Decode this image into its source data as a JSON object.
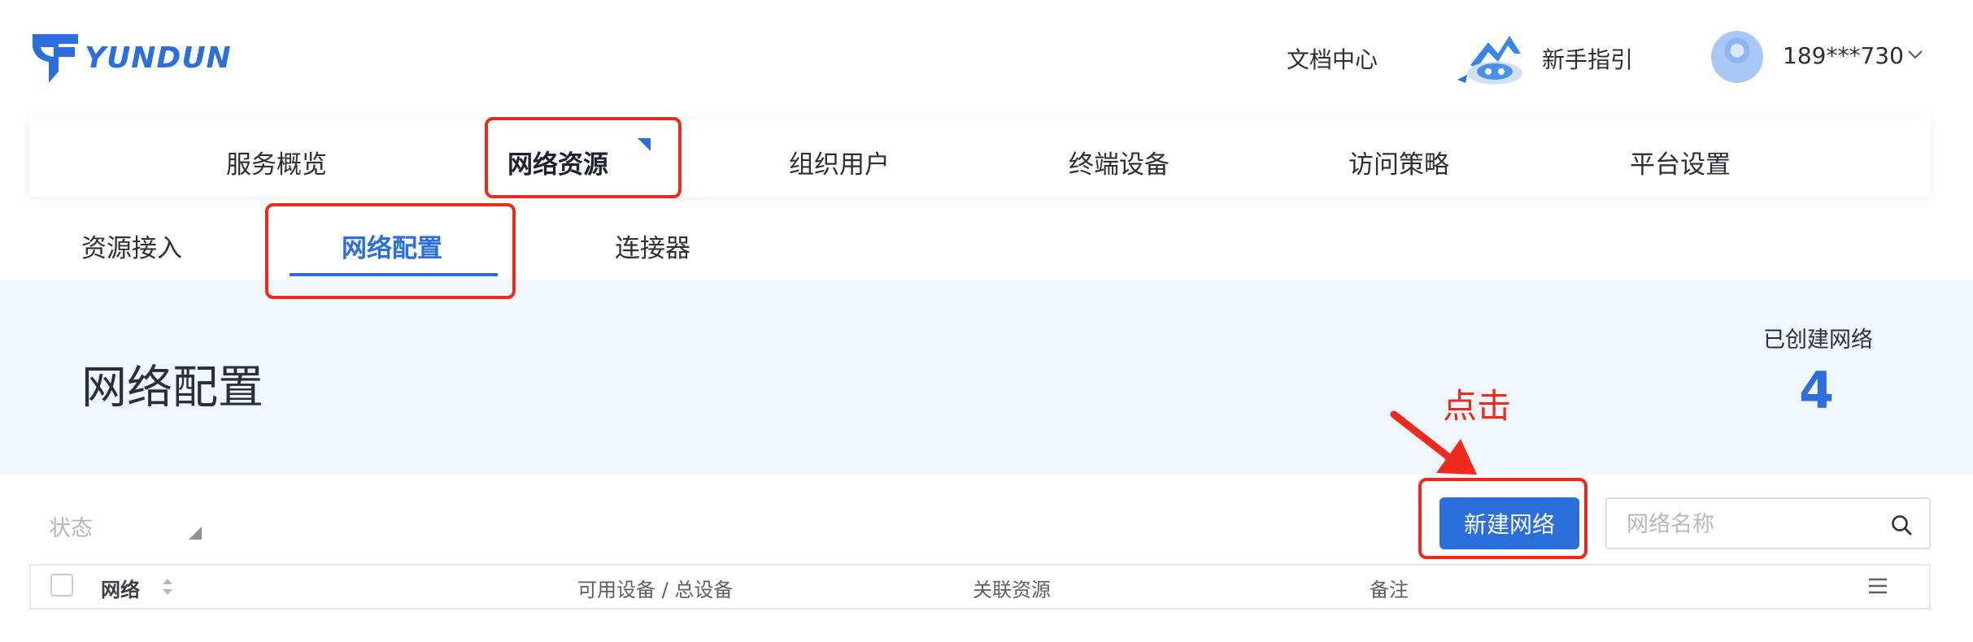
{
  "header": {
    "logo_text": "YUNDUN",
    "docs_label": "文档中心",
    "guide_label": "新手指引",
    "user_label": "189***730"
  },
  "main_nav": {
    "items": [
      {
        "label": "服务概览"
      },
      {
        "label": "网络资源",
        "active": true
      },
      {
        "label": "组织用户"
      },
      {
        "label": "终端设备"
      },
      {
        "label": "访问策略"
      },
      {
        "label": "平台设置"
      }
    ]
  },
  "sub_nav": {
    "items": [
      {
        "label": "资源接入"
      },
      {
        "label": "网络配置",
        "active": true
      },
      {
        "label": "连接器"
      }
    ]
  },
  "page": {
    "title": "网络配置",
    "created_label": "已创建网络",
    "created_count": "4"
  },
  "annotation": {
    "text": "点击",
    "color": "#ee2a1c"
  },
  "toolbar": {
    "status_placeholder": "状态",
    "new_button_label": "新建网络",
    "search_placeholder": "网络名称"
  },
  "table": {
    "columns": [
      "网络",
      "可用设备 / 总设备",
      "关联资源",
      "备注"
    ]
  },
  "colors": {
    "accent": "#2c6fdc",
    "banner_bg": "#f0f6fd",
    "annotation_red": "#ee2a1c"
  },
  "icons": [
    "yundun-logo-icon",
    "guide-mascot-icon",
    "avatar",
    "chevron-down-icon",
    "search-icon",
    "sort-icon",
    "column-menu-icon",
    "arrow-annotation-icon"
  ]
}
